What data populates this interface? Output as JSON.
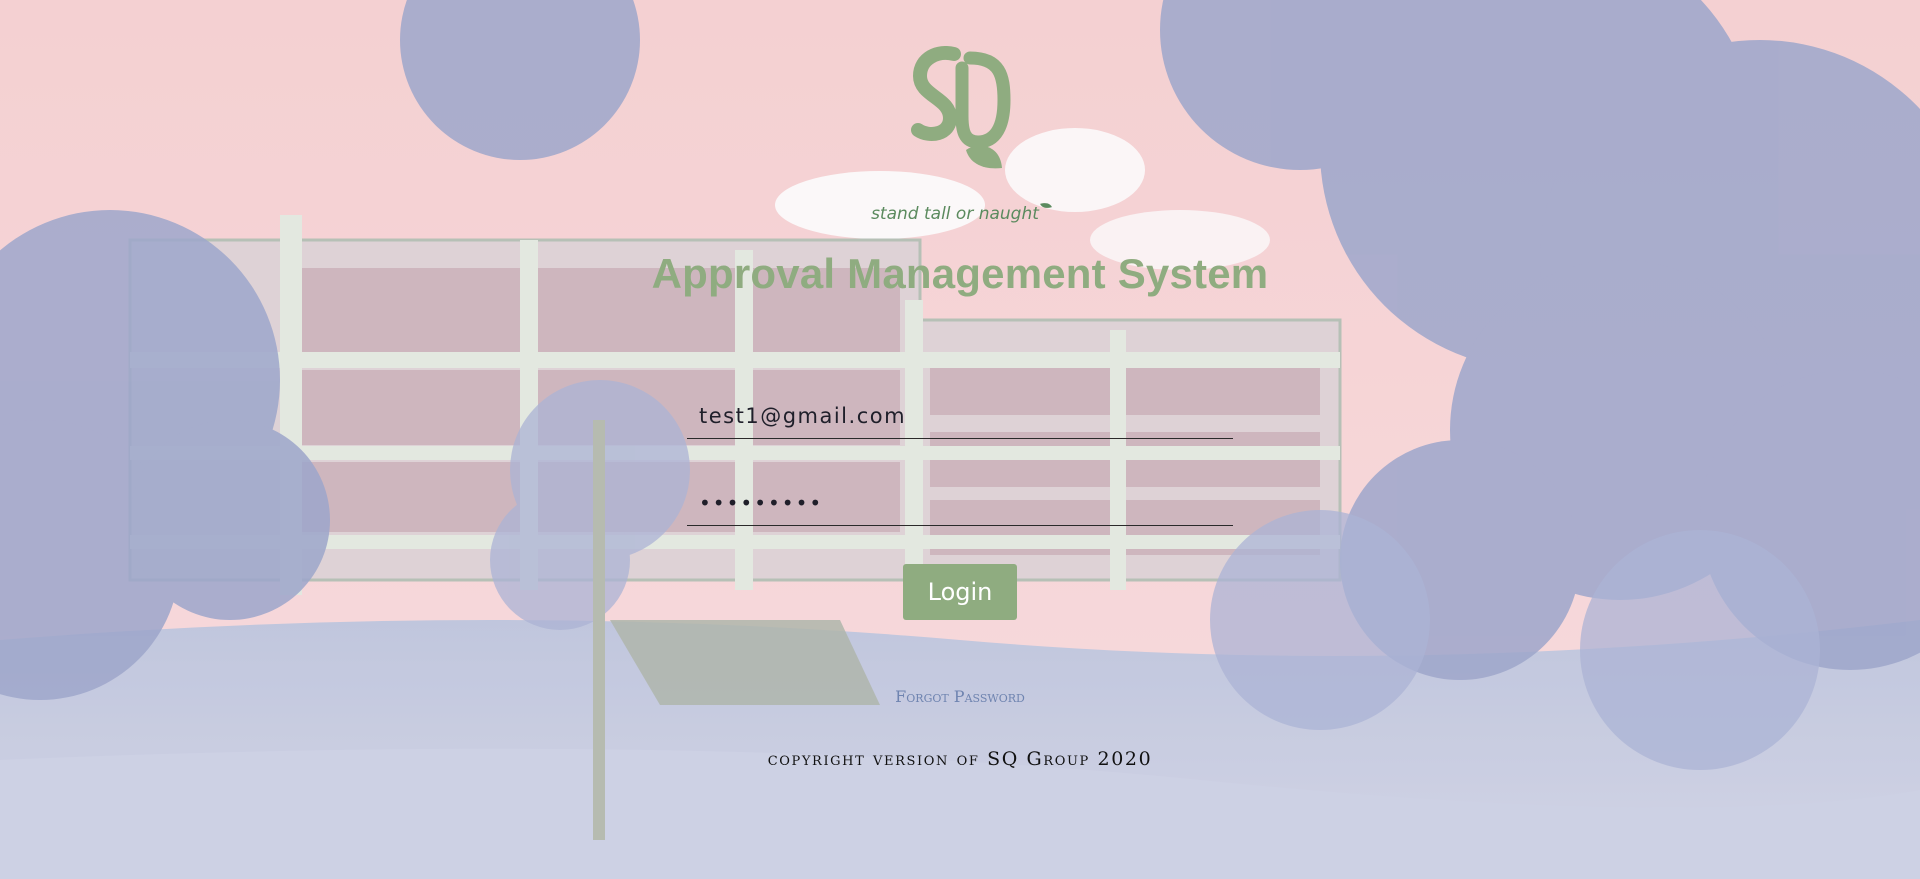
{
  "brand": {
    "logo_text": "SQ",
    "tagline": "stand tall or naught",
    "color": "#8fac80"
  },
  "page": {
    "title": "Approval Management System"
  },
  "form": {
    "email_value": "test1@gmail.com",
    "password_value": "•••••••••",
    "login_label": "Login",
    "forgot_label": "Forgot Password"
  },
  "footer": {
    "copyright": "copyright version of SQ Group 2020"
  },
  "icons": {
    "logo": "sq-logo-icon",
    "leaf": "leaf-icon"
  }
}
